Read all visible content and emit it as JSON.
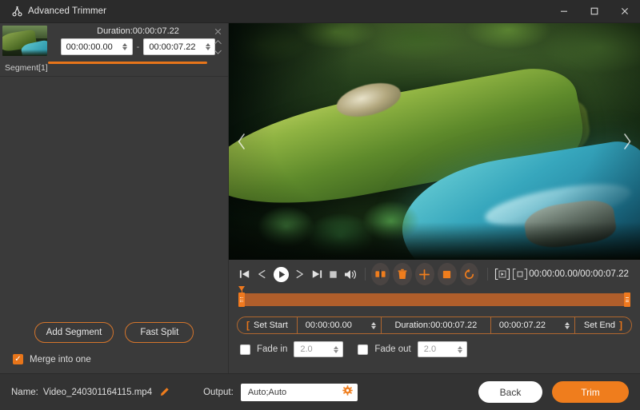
{
  "window": {
    "title": "Advanced Trimmer",
    "logo_icon": "scissors-icon",
    "minimize_icon": "minimize-icon",
    "maximize_icon": "maximize-icon",
    "close_icon": "close-icon"
  },
  "segment_panel": {
    "duration_label": "Duration:00:00:07.22",
    "start_time": "00:00:00.00",
    "end_time": "00:00:07.22",
    "separator": "-",
    "segment_name": "Segment[1]",
    "thumbnail_alt": "forest-stream-thumbnail",
    "close_icon": "close-icon",
    "move_up_icon": "chevron-up-icon",
    "move_down_icon": "chevron-down-icon",
    "add_segment_label": "Add Segment",
    "fast_split_label": "Fast Split",
    "merge_label": "Merge into one",
    "merge_checked": true
  },
  "preview": {
    "prev_icon": "chevron-left-icon",
    "next_icon": "chevron-right-icon",
    "scene_alt": "mossy-log-over-turquoise-stream"
  },
  "controls": {
    "buttons": [
      {
        "name": "jump-to-start-button",
        "icon": "skip-to-start-icon"
      },
      {
        "name": "step-backward-button",
        "icon": "rewind-icon"
      },
      {
        "name": "play-button",
        "icon": "play-icon"
      },
      {
        "name": "step-forward-button",
        "icon": "fast-forward-icon"
      },
      {
        "name": "jump-to-end-button",
        "icon": "skip-to-end-icon"
      },
      {
        "name": "stop-button",
        "icon": "stop-icon"
      },
      {
        "name": "volume-button",
        "icon": "speaker-icon"
      }
    ],
    "round_buttons": [
      {
        "name": "split-button",
        "icon": "split-icon"
      },
      {
        "name": "delete-button",
        "icon": "trash-icon"
      },
      {
        "name": "add-button",
        "icon": "plus-icon"
      },
      {
        "name": "crop-button",
        "icon": "square-icon"
      },
      {
        "name": "reset-button",
        "icon": "undo-icon"
      }
    ],
    "bracket_buttons": [
      {
        "name": "preview-clip-button",
        "icon": "bracket-play-icon"
      },
      {
        "name": "snapshot-button",
        "icon": "bracket-square-icon"
      }
    ],
    "time_readout": "00:00:00.00/00:00:07.22"
  },
  "timeline": {
    "selection_start_pct": 0,
    "selection_end_pct": 100,
    "playhead_pct": 0,
    "left_handle_name": "timeline-start-handle",
    "right_handle_name": "timeline-end-handle",
    "playhead_name": "timeline-playhead"
  },
  "trim_row": {
    "set_start_label": "Set Start",
    "set_start_bracket": "[",
    "start_value": "00:00:00.00",
    "duration_text": "Duration:00:00:07.22",
    "end_value": "00:00:07.22",
    "set_end_label": "Set End",
    "set_end_bracket": "]"
  },
  "fade_row": {
    "fade_in_label": "Fade in",
    "fade_in_value": "2.0",
    "fade_in_checked": false,
    "fade_out_label": "Fade out",
    "fade_out_value": "2.0",
    "fade_out_checked": false
  },
  "bottom_bar": {
    "name_label": "Name:",
    "file_name": "Video_240301164115.mp4",
    "edit_icon": "pencil-icon",
    "output_label": "Output:",
    "output_value": "Auto;Auto",
    "output_settings_icon": "gear-icon",
    "back_label": "Back",
    "trim_label": "Trim"
  },
  "colors": {
    "accent": "#ef7d1d",
    "accent_border": "#d4752c",
    "window_bg": "#3a3a3a",
    "titlebar_bg": "#2b2b2b",
    "bottombar_bg": "#333333",
    "timeline_selection": "#b05e2b"
  }
}
